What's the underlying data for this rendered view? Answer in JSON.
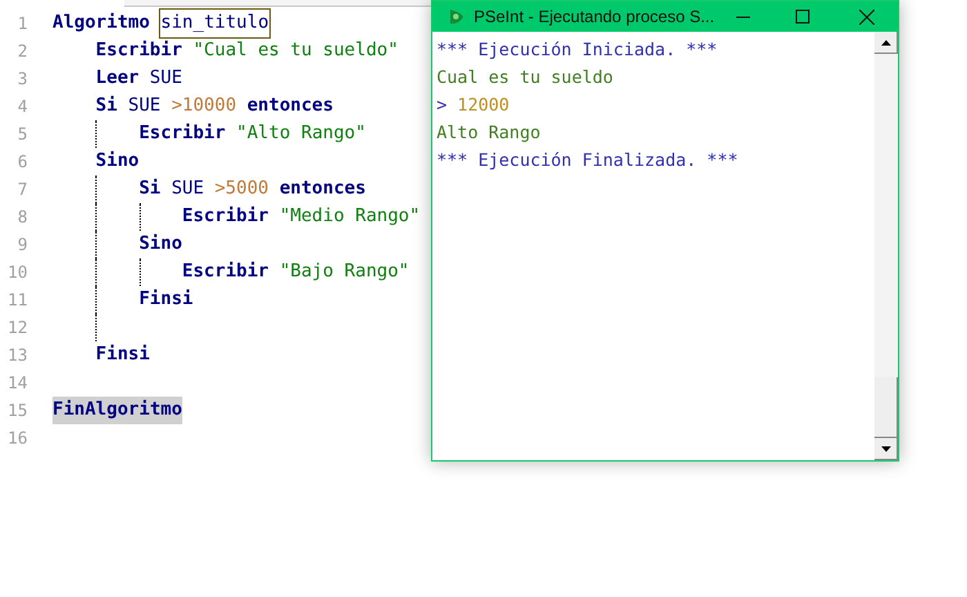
{
  "editor": {
    "lines": [
      {
        "number": "1",
        "tokens": [
          {
            "kind": "keyword",
            "text": "Algoritmo"
          },
          {
            "kind": "space"
          },
          {
            "kind": "ident",
            "text": "sin_titulo",
            "boxed": true
          }
        ]
      },
      {
        "number": "2",
        "tokens": [
          {
            "kind": "indent"
          },
          {
            "kind": "keyword",
            "text": "Escribir"
          },
          {
            "kind": "space"
          },
          {
            "kind": "string",
            "text": "\"Cual es tu sueldo\""
          }
        ]
      },
      {
        "number": "3",
        "tokens": [
          {
            "kind": "indent"
          },
          {
            "kind": "keyword",
            "text": "Leer"
          },
          {
            "kind": "space"
          },
          {
            "kind": "plain",
            "text": "SUE"
          }
        ]
      },
      {
        "number": "4",
        "tokens": [
          {
            "kind": "indent"
          },
          {
            "kind": "keyword",
            "text": "Si"
          },
          {
            "kind": "space"
          },
          {
            "kind": "plain",
            "text": "SUE"
          },
          {
            "kind": "space"
          },
          {
            "kind": "number",
            "text": ">10000"
          },
          {
            "kind": "space"
          },
          {
            "kind": "keyword",
            "text": "entonces"
          }
        ]
      },
      {
        "number": "5",
        "tokens": [
          {
            "kind": "indent"
          },
          {
            "kind": "guide"
          },
          {
            "kind": "keyword",
            "text": "Escribir"
          },
          {
            "kind": "space"
          },
          {
            "kind": "string",
            "text": "\"Alto Rango\""
          }
        ]
      },
      {
        "number": "6",
        "tokens": [
          {
            "kind": "indent"
          },
          {
            "kind": "keyword",
            "text": "Sino"
          }
        ]
      },
      {
        "number": "7",
        "tokens": [
          {
            "kind": "indent"
          },
          {
            "kind": "guide"
          },
          {
            "kind": "keyword",
            "text": "Si"
          },
          {
            "kind": "space"
          },
          {
            "kind": "plain",
            "text": "SUE"
          },
          {
            "kind": "space"
          },
          {
            "kind": "number",
            "text": ">5000"
          },
          {
            "kind": "space"
          },
          {
            "kind": "keyword",
            "text": "entonces"
          }
        ]
      },
      {
        "number": "8",
        "tokens": [
          {
            "kind": "indent"
          },
          {
            "kind": "guide"
          },
          {
            "kind": "guide"
          },
          {
            "kind": "keyword",
            "text": "Escribir"
          },
          {
            "kind": "space"
          },
          {
            "kind": "string",
            "text": "\"Medio Rango\""
          }
        ]
      },
      {
        "number": "9",
        "tokens": [
          {
            "kind": "indent"
          },
          {
            "kind": "guide"
          },
          {
            "kind": "keyword",
            "text": "Sino"
          }
        ]
      },
      {
        "number": "10",
        "tokens": [
          {
            "kind": "indent"
          },
          {
            "kind": "guide"
          },
          {
            "kind": "guide"
          },
          {
            "kind": "keyword",
            "text": "Escribir"
          },
          {
            "kind": "space"
          },
          {
            "kind": "string",
            "text": "\"Bajo Rango\""
          }
        ]
      },
      {
        "number": "11",
        "tokens": [
          {
            "kind": "indent"
          },
          {
            "kind": "guide"
          },
          {
            "kind": "keyword",
            "text": "Finsi"
          }
        ]
      },
      {
        "number": "12",
        "tokens": [
          {
            "kind": "indent"
          },
          {
            "kind": "guide"
          }
        ]
      },
      {
        "number": "13",
        "tokens": [
          {
            "kind": "indent"
          },
          {
            "kind": "keyword",
            "text": "Finsi"
          }
        ]
      },
      {
        "number": "14"
      },
      {
        "number": "15",
        "tokens": [
          {
            "kind": "keyword",
            "text": "FinAlgoritmo",
            "highlighted": true
          }
        ]
      },
      {
        "number": "16"
      }
    ]
  },
  "console_window": {
    "title": "PSeInt - Ejecutando proceso S...",
    "lines": [
      [
        {
          "kind": "system",
          "text": "*** Ejecución Iniciada. ***"
        }
      ],
      [
        {
          "kind": "output",
          "text": "Cual es tu sueldo"
        }
      ],
      [
        {
          "kind": "prompt",
          "text": ">"
        },
        {
          "kind": "space"
        },
        {
          "kind": "input",
          "text": "12000"
        }
      ],
      [
        {
          "kind": "output",
          "text": "Alto Rango"
        }
      ],
      [
        {
          "kind": "system",
          "text": "*** Ejecución Finalizada. ***"
        }
      ]
    ]
  }
}
